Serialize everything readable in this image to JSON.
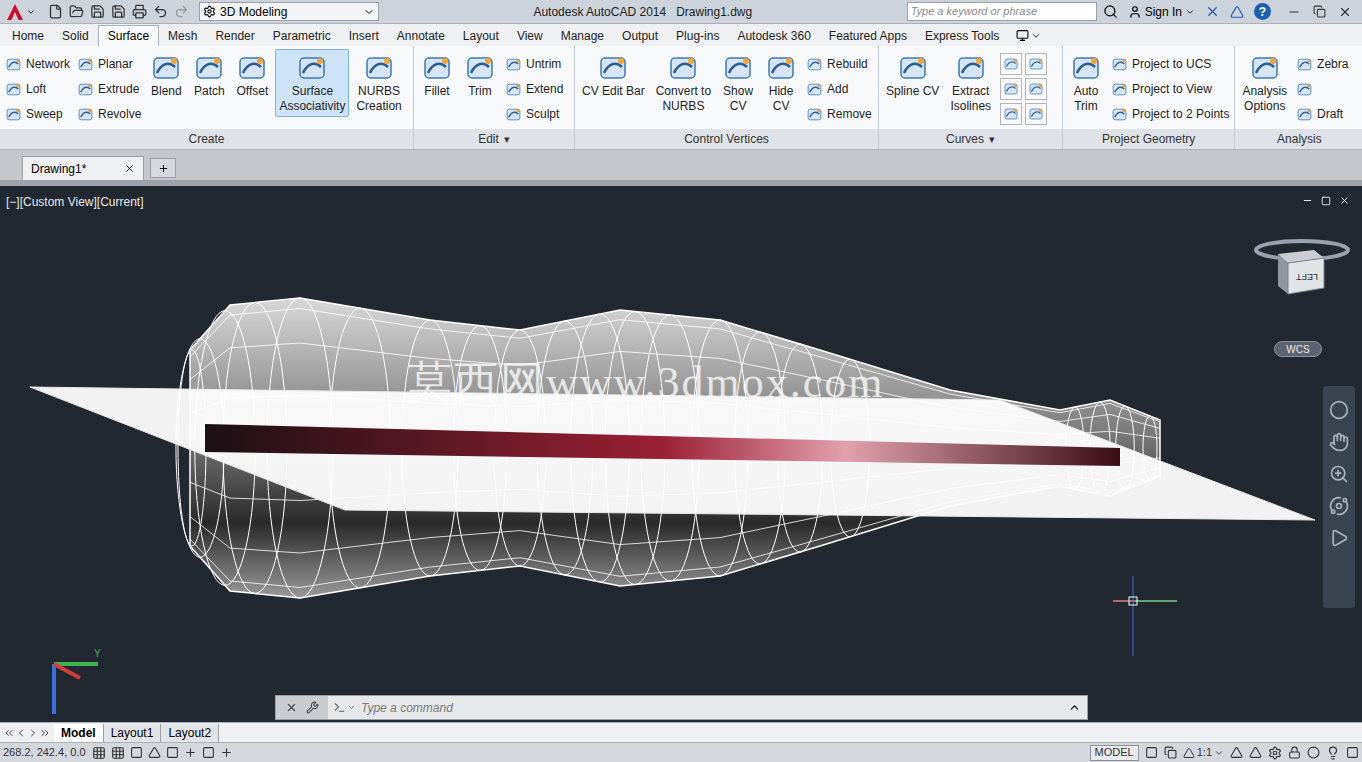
{
  "title_bar": {
    "workspace": "3D Modeling",
    "app": "Autodesk AutoCAD 2014",
    "file": "Drawing1.dwg",
    "search": {
      "placeholder": "Type a keyword or phrase"
    },
    "sign_in": "Sign In",
    "help": "?"
  },
  "ribbon_tabs": [
    {
      "label": "Home",
      "selected": false
    },
    {
      "label": "Solid",
      "selected": false
    },
    {
      "label": "Surface",
      "selected": true
    },
    {
      "label": "Mesh",
      "selected": false
    },
    {
      "label": "Render",
      "selected": false
    },
    {
      "label": "Parametric",
      "selected": false
    },
    {
      "label": "Insert",
      "selected": false
    },
    {
      "label": "Annotate",
      "selected": false
    },
    {
      "label": "Layout",
      "selected": false
    },
    {
      "label": "View",
      "selected": false
    },
    {
      "label": "Manage",
      "selected": false
    },
    {
      "label": "Output",
      "selected": false
    },
    {
      "label": "Plug-ins",
      "selected": false
    },
    {
      "label": "Autodesk 360",
      "selected": false
    },
    {
      "label": "Featured Apps",
      "selected": false
    },
    {
      "label": "Express Tools",
      "selected": false
    }
  ],
  "ribbon_panels": [
    {
      "label": "Create",
      "arrow": "",
      "groups": [
        {
          "kind": "stack",
          "items": [
            {
              "kind": "text",
              "label": "Network"
            },
            {
              "kind": "text",
              "label": "Loft"
            },
            {
              "kind": "text",
              "label": "Sweep"
            }
          ]
        },
        {
          "kind": "stack",
          "items": [
            {
              "kind": "text",
              "label": "Planar"
            },
            {
              "kind": "text",
              "label": "Extrude"
            },
            {
              "kind": "text",
              "label": "Revolve"
            }
          ]
        },
        {
          "kind": "large",
          "lines": [
            "Blend"
          ],
          "selected": false
        },
        {
          "kind": "large",
          "lines": [
            "Patch"
          ],
          "selected": false
        },
        {
          "kind": "large",
          "lines": [
            "Offset"
          ],
          "selected": false
        },
        {
          "kind": "large",
          "lines": [
            "Surface",
            "Associativity"
          ],
          "selected": true
        },
        {
          "kind": "large",
          "lines": [
            "NURBS",
            "Creation"
          ],
          "selected": false
        }
      ]
    },
    {
      "label": "Edit",
      "arrow": "▾",
      "groups": [
        {
          "kind": "large",
          "lines": [
            "Fillet"
          ],
          "selected": false
        },
        {
          "kind": "large",
          "lines": [
            "Trim"
          ],
          "selected": false
        },
        {
          "kind": "stack",
          "items": [
            {
              "kind": "text",
              "label": "Untrim"
            },
            {
              "kind": "text",
              "label": "Extend"
            },
            {
              "kind": "text",
              "label": "Sculpt"
            }
          ]
        }
      ]
    },
    {
      "label": "Control Vertices",
      "arrow": "",
      "groups": [
        {
          "kind": "large",
          "lines": [
            "CV Edit Bar"
          ],
          "selected": false
        },
        {
          "kind": "large",
          "lines": [
            "Convert to",
            "NURBS"
          ],
          "selected": false
        },
        {
          "kind": "large",
          "lines": [
            "Show",
            "CV"
          ],
          "selected": false
        },
        {
          "kind": "large",
          "lines": [
            "Hide",
            "CV"
          ],
          "selected": false
        },
        {
          "kind": "stack",
          "items": [
            {
              "kind": "text",
              "label": "Rebuild"
            },
            {
              "kind": "text",
              "label": "Add"
            },
            {
              "kind": "text",
              "label": "Remove"
            }
          ]
        }
      ]
    },
    {
      "label": "Curves",
      "arrow": "▾",
      "groups": [
        {
          "kind": "large",
          "lines": [
            "Spline CV"
          ],
          "selected": false
        },
        {
          "kind": "large",
          "lines": [
            "Extract",
            "Isolines"
          ],
          "selected": false
        },
        {
          "kind": "grid"
        }
      ]
    },
    {
      "label": "Project Geometry",
      "arrow": "",
      "groups": [
        {
          "kind": "large",
          "lines": [
            "Auto",
            "Trim"
          ],
          "selected": false
        },
        {
          "kind": "stack",
          "items": [
            {
              "kind": "text",
              "label": "Project to UCS"
            },
            {
              "kind": "text",
              "label": "Project to View"
            },
            {
              "kind": "text",
              "label": "Project to 2 Points"
            }
          ]
        }
      ]
    },
    {
      "label": "Analysis",
      "arrow": "",
      "groups": [
        {
          "kind": "large",
          "lines": [
            "Analysis",
            "Options"
          ],
          "selected": false
        },
        {
          "kind": "stack",
          "items": [
            {
              "kind": "text",
              "label": "Zebra"
            },
            {
              "kind": "icon"
            },
            {
              "kind": "text",
              "label": "Draft"
            }
          ]
        }
      ]
    }
  ],
  "file_tabs": [
    {
      "label": "Drawing1*",
      "selected": true
    }
  ],
  "viewport": {
    "label": "[−][Custom View][Current]",
    "viewcube_face": "LEFT",
    "ucs_badge": "WCS",
    "ucs_axis": "Y",
    "watermark": "莫西网www.3dmox.com"
  },
  "command_line": {
    "placeholder": "Type a command"
  },
  "layout_tabs": [
    {
      "label": "Model",
      "selected": true
    },
    {
      "label": "Layout1",
      "selected": false
    },
    {
      "label": "Layout2",
      "selected": false
    }
  ],
  "status_bar": {
    "coordinates": "268.2, 242.4, 0.0",
    "space": "MODEL",
    "scale": "1:1"
  }
}
